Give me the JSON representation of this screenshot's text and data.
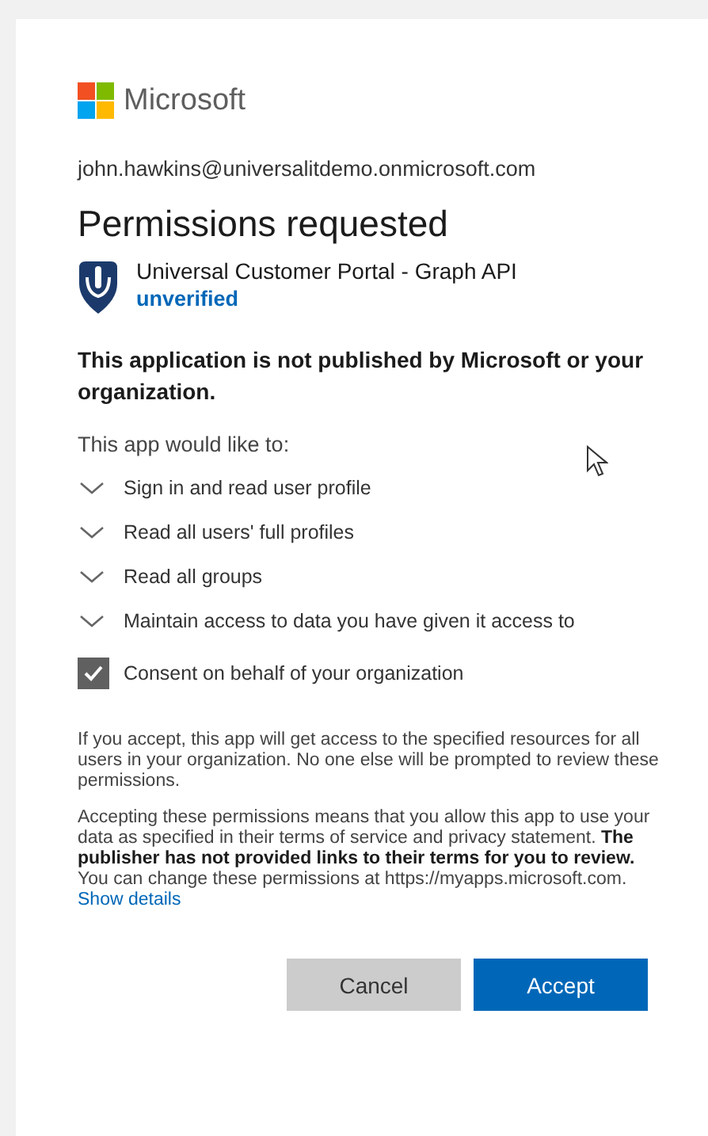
{
  "brand": {
    "name": "Microsoft"
  },
  "account": "john.hawkins@universalitdemo.onmicrosoft.com",
  "title": "Permissions requested",
  "app": {
    "name": "Universal Customer Portal - Graph API",
    "status": "unverified"
  },
  "notice": "This application is not published by Microsoft or your organization.",
  "intro": "This app would like to:",
  "permissions": [
    {
      "label": "Sign in and read user profile",
      "expanded": false
    },
    {
      "label": "Read all users' full profiles",
      "expanded": false
    },
    {
      "label": "Read all groups",
      "expanded": false
    },
    {
      "label": "Maintain access to data you have given it access to",
      "expanded": false
    }
  ],
  "consent": {
    "label": "Consent on behalf of your organization",
    "checked": true
  },
  "info": "If you accept, this app will get access to the specified resources for all users in your organization. No one else will be prompted to review these permissions.",
  "terms": "Accepting these permissions means that you allow this app to use your data as specified in their terms of service and privacy statement. **The publisher has not provided links to their terms for you to review.** You can change these permissions at https://myapps.microsoft.com.",
  "details_link": "Show details",
  "buttons": [
    {
      "label": "Cancel",
      "kind": "secondary"
    },
    {
      "label": "Accept",
      "kind": "primary"
    }
  ]
}
